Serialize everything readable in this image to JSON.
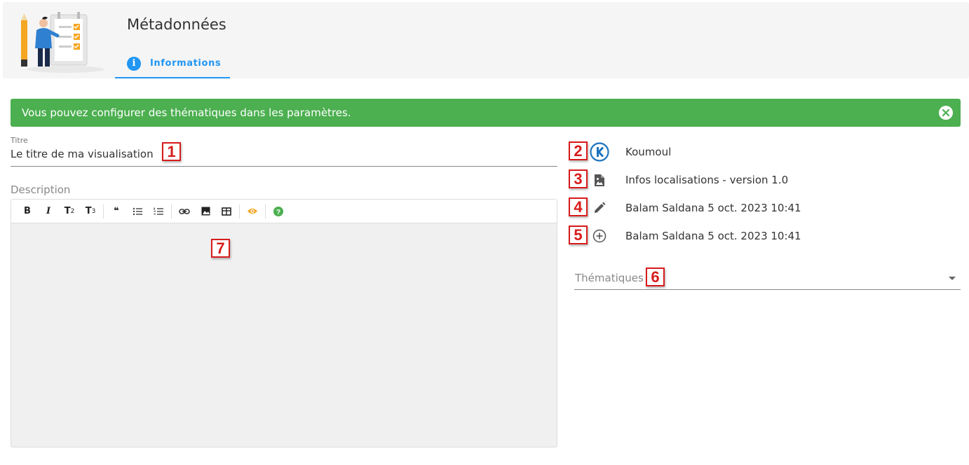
{
  "header": {
    "title": "Métadonnées",
    "tabs": [
      {
        "label": "Informations",
        "icon": "info-icon",
        "active": true
      }
    ]
  },
  "alert": {
    "text": "Vous pouvez configurer des thématiques dans les paramètres.",
    "color": "#4caf50"
  },
  "form": {
    "title_label": "Titre",
    "title_value": "Le titre de ma visualisation",
    "description_label": "Description",
    "toolbar": {
      "bold": "B",
      "italic": "I",
      "t2": "T",
      "t2_sub": "2",
      "t3": "T",
      "t3_sub": "3",
      "quote": "❝",
      "icons": [
        "bold-icon",
        "italic-icon",
        "heading2-icon",
        "heading3-icon",
        "quote-icon",
        "bullet-list-icon",
        "ordered-list-icon",
        "link-icon",
        "image-icon",
        "table-icon",
        "preview-eye-icon",
        "help-icon"
      ]
    }
  },
  "meta": {
    "organization": "Koumoul",
    "dataset": "Infos localisations - version 1.0",
    "updated": "Balam Saldana 5 oct. 2023 10:41",
    "created": "Balam Saldana 5 oct. 2023 10:41",
    "topics_label": "Thématiques"
  },
  "annotations": [
    "1",
    "2",
    "3",
    "4",
    "5",
    "6",
    "7"
  ],
  "colors": {
    "accent": "#2196f3",
    "success": "#4caf50",
    "badge": "#d81b1b"
  }
}
